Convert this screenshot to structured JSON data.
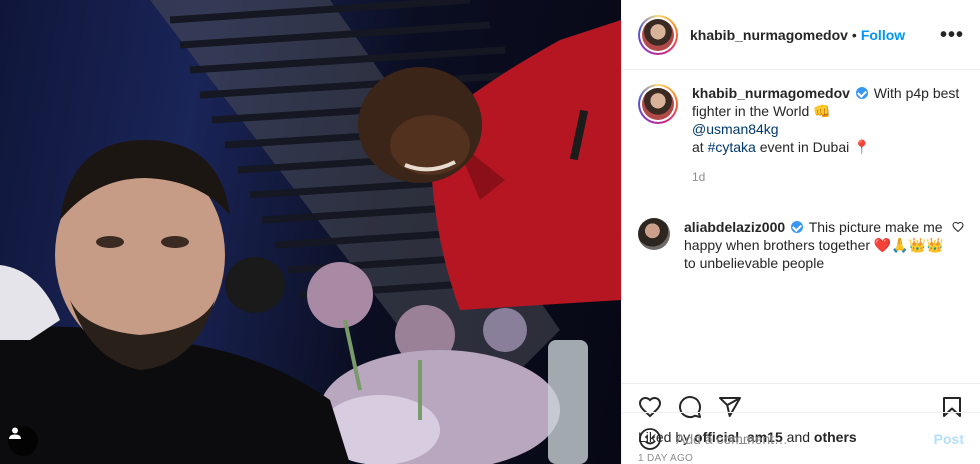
{
  "header": {
    "username": "khabib_nurmagomedov",
    "dot": "•",
    "follow_label": "Follow",
    "more_label": "•••"
  },
  "caption": {
    "username": "khabib_nurmagomedov",
    "text_1": "With p4p best fighter in the World",
    "emoji_1": "👊",
    "mention": "@usman84kg",
    "text_2": "at",
    "hashtag": "#cytaka",
    "text_3": "event in Dubai",
    "emoji_2": "📍",
    "age": "1d"
  },
  "comment": {
    "username": "aliabdelaziz000",
    "text_1": "This picture make me happy when brothers together",
    "emojis": "❤️🙏👑👑",
    "text_2": "to unbelievable people"
  },
  "likes": {
    "prefix": "Liked by",
    "user": "official_am15",
    "middle": "and",
    "suffix": "others"
  },
  "post_time": "1 DAY AGO",
  "add_comment": {
    "placeholder": "Add a comment…",
    "post_label": "Post"
  },
  "icons": {
    "like": "heart-icon",
    "comment": "comment-icon",
    "share": "share-icon",
    "save": "bookmark-icon",
    "emoji": "smiley-icon",
    "user_tag": "user-tag-icon"
  },
  "colors": {
    "link_blue": "#0095f6",
    "verified_blue": "#3897f0",
    "mention": "#00376b",
    "muted": "#8e8e8e"
  }
}
